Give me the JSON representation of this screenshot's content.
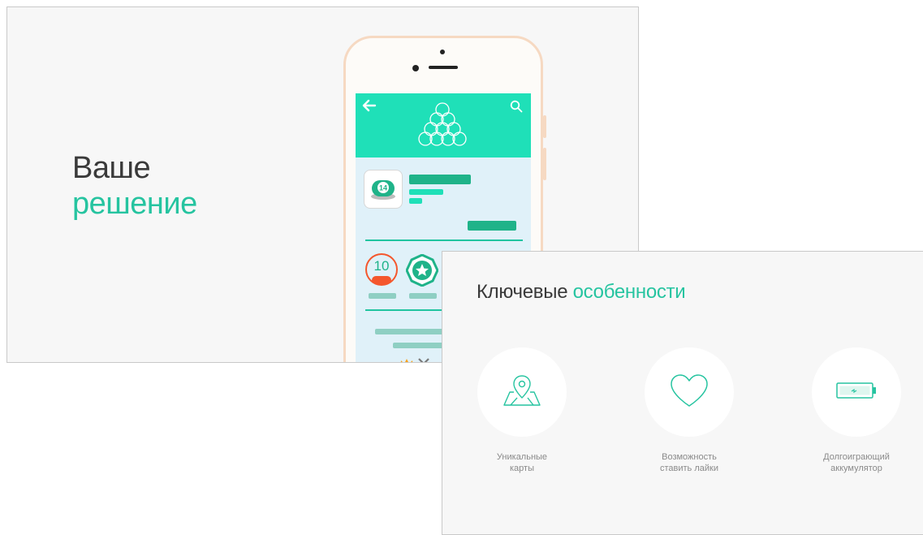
{
  "slide1": {
    "headline_line1": "Ваше",
    "headline_line2": "решение",
    "phone": {
      "app_badge_number": "14",
      "badge_level": "10"
    }
  },
  "slide2": {
    "title_part1": "Ключевые ",
    "title_part2": "особенности",
    "features": [
      {
        "icon": "map-pin-icon",
        "line1": "Уникальные",
        "line2": "карты"
      },
      {
        "icon": "heart-icon",
        "line1": "Возможность",
        "line2": "ставить лайки"
      },
      {
        "icon": "battery-icon",
        "line1": "Долгоиграющий",
        "line2": "аккумулятор"
      }
    ]
  },
  "colors": {
    "accent": "#26c4a0",
    "appbar": "#1fe0b8",
    "orange": "#f4572d",
    "phone_frame": "#f6d9c2"
  }
}
